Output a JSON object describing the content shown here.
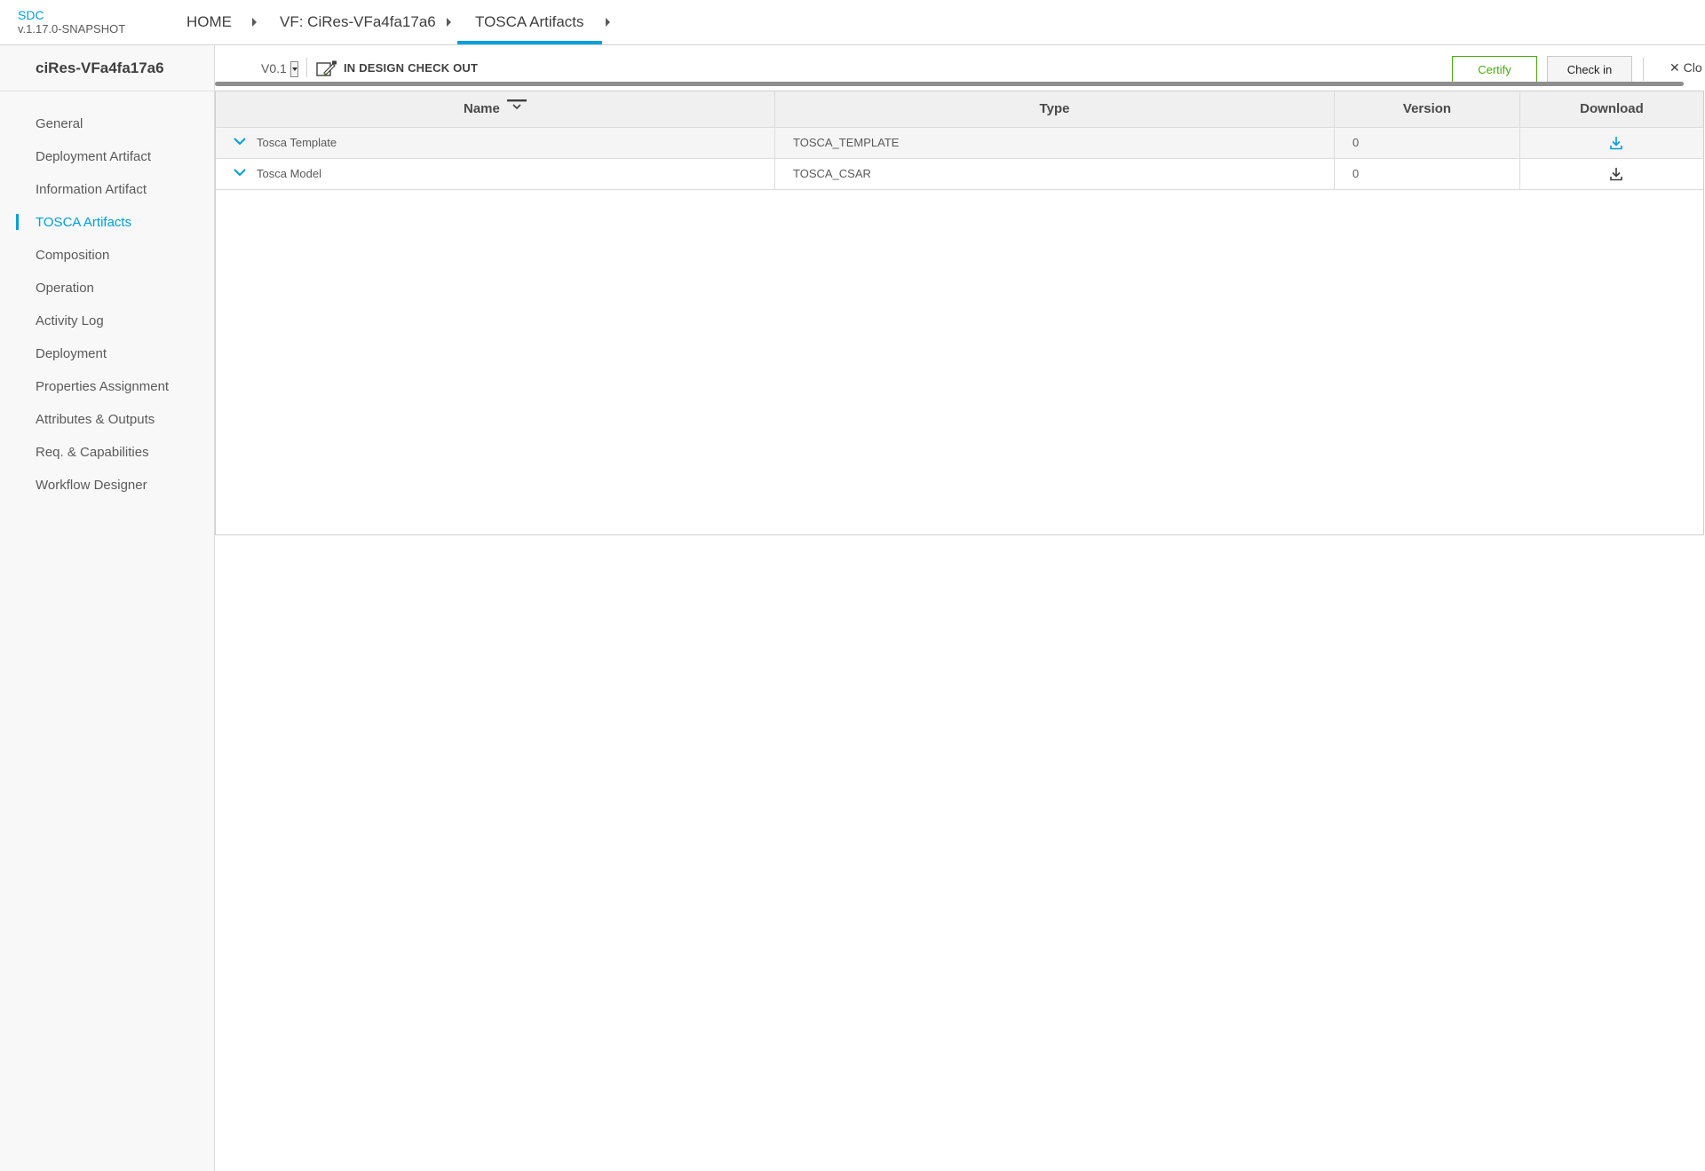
{
  "header": {
    "app_name": "SDC",
    "app_version": "v.1.17.0-SNAPSHOT",
    "breadcrumbs": [
      {
        "label": "HOME"
      },
      {
        "label": "VF: CiRes-VFa4fa17a6"
      },
      {
        "label": "TOSCA Artifacts"
      }
    ]
  },
  "sidebar": {
    "title": "ciRes-VFa4fa17a6",
    "items": [
      {
        "label": "General"
      },
      {
        "label": "Deployment Artifact"
      },
      {
        "label": "Information Artifact"
      },
      {
        "label": "TOSCA Artifacts",
        "active": true
      },
      {
        "label": "Composition"
      },
      {
        "label": "Operation"
      },
      {
        "label": "Activity Log"
      },
      {
        "label": "Deployment"
      },
      {
        "label": "Properties Assignment"
      },
      {
        "label": "Attributes & Outputs"
      },
      {
        "label": "Req. & Capabilities"
      },
      {
        "label": "Workflow Designer"
      }
    ]
  },
  "toolbar": {
    "version": "V0.1",
    "status": "IN DESIGN CHECK OUT",
    "certify_label": "Certify",
    "checkin_label": "Check in",
    "close_label": "Clo"
  },
  "table": {
    "columns": [
      "Name",
      "Type",
      "Version",
      "Download"
    ],
    "rows": [
      {
        "name": "Tosca Template",
        "type": "TOSCA_TEMPLATE",
        "version": "0",
        "download_icon_color": "#009fdb"
      },
      {
        "name": "Tosca Model",
        "type": "TOSCA_CSAR",
        "version": "0",
        "download_icon_color": "#3f3f3f"
      }
    ]
  },
  "colors": {
    "accent": "#009fdb",
    "certify": "#4ca90c",
    "text": "#3f3f3f"
  }
}
